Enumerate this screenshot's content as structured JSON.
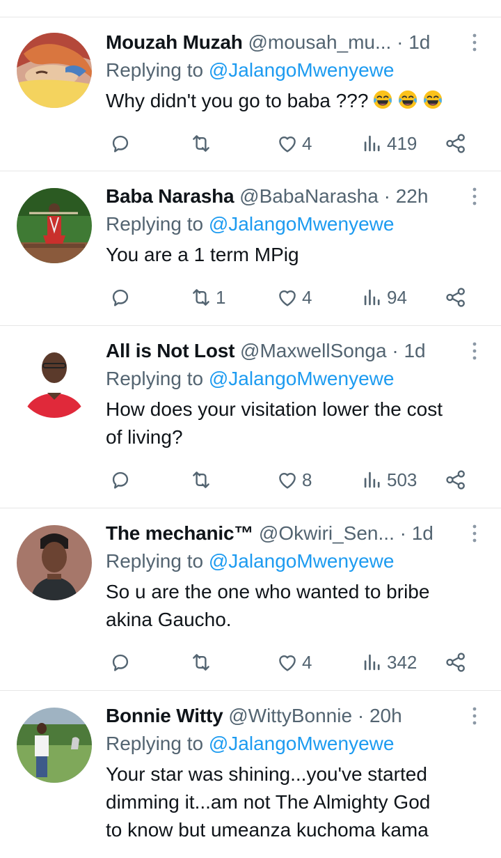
{
  "reply_prefix": "Replying to",
  "tweets": [
    {
      "name": "Mouzah Muzah",
      "handle": "@mousah_mu...",
      "separator": "·",
      "time": "1d",
      "replying_to": "@JalangoMwenyewe",
      "text": "Why didn't you go to baba ???",
      "emojis": [
        "face-with-tears-of-joy",
        "face-with-tears-of-joy",
        "face-with-tears-of-joy"
      ],
      "replies": "",
      "retweets": "",
      "likes": "4",
      "views": "419"
    },
    {
      "name": "Baba Narasha",
      "handle": "@BabaNarasha",
      "separator": "·",
      "time": "22h",
      "replying_to": "@JalangoMwenyewe",
      "text": "You are a 1 term MPig",
      "replies": "",
      "retweets": "1",
      "likes": "4",
      "views": "94"
    },
    {
      "name": "All is Not Lost",
      "handle": "@MaxwellSonga",
      "separator": "·",
      "time": "1d",
      "replying_to": "@JalangoMwenyewe",
      "text_lines": [
        "How does your visitation lower the cost",
        "of living?"
      ],
      "replies": "",
      "retweets": "",
      "likes": "8",
      "views": "503"
    },
    {
      "name": "The mechanic™",
      "handle": "@Okwiri_Sen...",
      "separator": "·",
      "time": "1d",
      "replying_to": "@JalangoMwenyewe",
      "text_lines": [
        "So u are the one who wanted to bribe",
        "akina Gaucho."
      ],
      "replies": "",
      "retweets": "",
      "likes": "4",
      "views": "342"
    },
    {
      "name": "Bonnie Witty",
      "handle": "@WittyBonnie",
      "separator": "·",
      "time": "20h",
      "replying_to": "@JalangoMwenyewe",
      "text_lines": [
        "Your star was shining...you've started",
        "dimming it...am not The Almighty God",
        "to know but umeanza kuchoma kama"
      ]
    }
  ],
  "colors": {
    "text": "#0f1419",
    "secondary": "#536471",
    "link": "#1d9bf0",
    "divider": "#e6e6e6"
  },
  "icons": [
    "reply-icon",
    "retweet-icon",
    "like-icon",
    "views-icon",
    "share-icon",
    "more-icon"
  ]
}
